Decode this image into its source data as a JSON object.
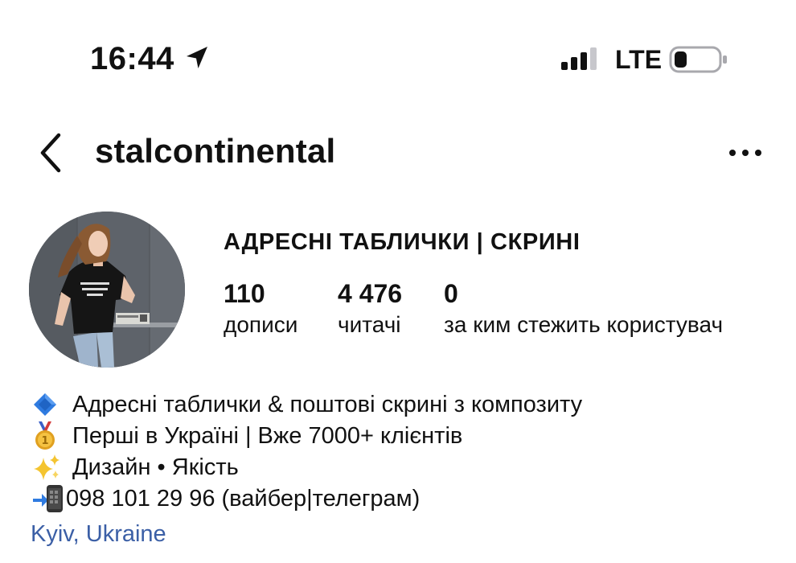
{
  "status_bar": {
    "time": "16:44",
    "network": "LTE",
    "icons": [
      "location-arrow-icon",
      "signal-bars-icon",
      "battery-icon"
    ]
  },
  "nav": {
    "username": "stalcontinental",
    "icons": [
      "chevron-left-icon",
      "more-horizontal-icon"
    ]
  },
  "profile": {
    "name": "АДРЕСНІ ТАБЛИЧКИ | СКРИНІ",
    "avatar": "profile-avatar",
    "stats": [
      {
        "count": "110",
        "label": "дописи"
      },
      {
        "count": "4 476",
        "label": "читачі"
      },
      {
        "count": "0",
        "label": "за ким стежить користувач"
      }
    ]
  },
  "bio": {
    "lines": [
      {
        "icon": "blue-diamond-icon",
        "text": "Адресні таблички & поштові скрині з композиту"
      },
      {
        "icon": "first-place-medal-icon",
        "text": "Перші в Україні | Вже 7000+ клієнтів"
      },
      {
        "icon": "sparkles-icon",
        "text": "Дизайн • Якість"
      },
      {
        "icon": "mobile-phone-arrow-icon",
        "text": "098 101 29 96 (вайбер|телеграм)"
      }
    ],
    "location": "Kyiv, Ukraine"
  },
  "colors": {
    "text": "#111111",
    "link": "#3b5fa6",
    "background": "#ffffff",
    "diamond": "#2f7be0",
    "medal": "#e0a020",
    "sparkle": "#f4c430"
  }
}
